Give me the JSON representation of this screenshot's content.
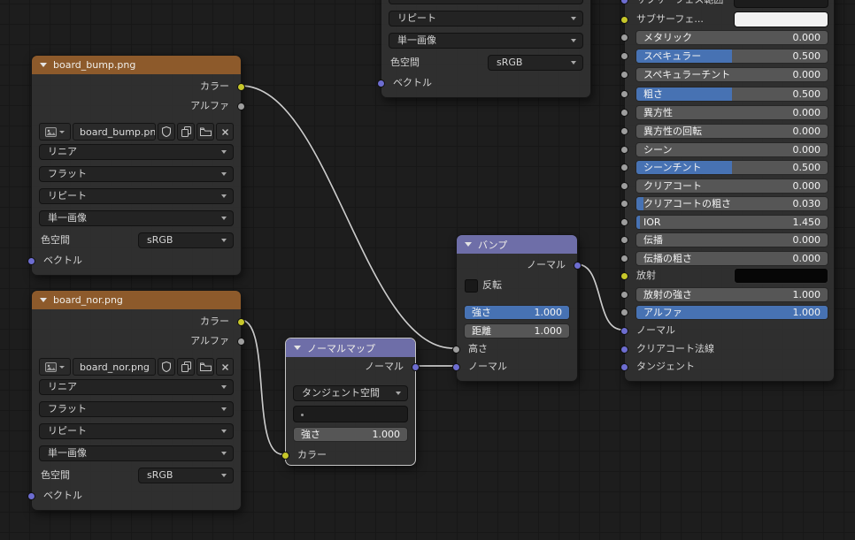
{
  "board_bump": {
    "title": "board_bump.png",
    "outputs": {
      "color": "カラー",
      "alpha": "アルファ"
    },
    "image_name": "board_bump.png",
    "interpolation": "リニア",
    "projection": "フラット",
    "extension": "リピート",
    "source": "単一画像",
    "colorspace_label": "色空間",
    "colorspace_value": "sRGB",
    "vector_label": "ベクトル"
  },
  "board_nor": {
    "title": "board_nor.png",
    "outputs": {
      "color": "カラー",
      "alpha": "アルファ"
    },
    "image_name": "board_nor.png",
    "interpolation": "リニア",
    "projection": "フラット",
    "extension": "リピート",
    "source": "単一画像",
    "colorspace_label": "色空間",
    "colorspace_value": "sRGB",
    "vector_label": "ベクトル"
  },
  "partial_texture": {
    "extension": "リピート",
    "source": "単一画像",
    "colorspace_label": "色空間",
    "colorspace_value": "sRGB",
    "vector_label": "ベクトル"
  },
  "normal_map": {
    "title": "ノーマルマップ",
    "output": "ノーマル",
    "space": "タンジェント空間",
    "strength_label": "強さ",
    "strength_value": "1.000",
    "color_label": "カラー"
  },
  "bump": {
    "title": "バンプ",
    "output": "ノーマル",
    "invert_label": "反転",
    "strength_label": "強さ",
    "strength_value": "1.000",
    "distance_label": "距離",
    "distance_value": "1.000",
    "height_label": "高さ",
    "normal_label": "ノーマル"
  },
  "principled": {
    "radius_label": "サブサーフェス範囲",
    "subsurface_color_label": "サブサーフェ...",
    "sliders": [
      {
        "label": "メタリック",
        "value": "0.000"
      },
      {
        "label": "スペキュラー",
        "value": "0.500"
      },
      {
        "label": "スペキュラーチント",
        "value": "0.000"
      },
      {
        "label": "粗さ",
        "value": "0.500"
      },
      {
        "label": "異方性",
        "value": "0.000"
      },
      {
        "label": "異方性の回転",
        "value": "0.000"
      },
      {
        "label": "シーン",
        "value": "0.000"
      },
      {
        "label": "シーンチント",
        "value": "0.500"
      },
      {
        "label": "クリアコート",
        "value": "0.000"
      },
      {
        "label": "クリアコートの粗さ",
        "value": "0.030"
      },
      {
        "label": "IOR",
        "value": "1.450"
      },
      {
        "label": "伝播",
        "value": "0.000"
      },
      {
        "label": "伝播の粗さ",
        "value": "0.000"
      }
    ],
    "emission_label": "放射",
    "emission_strength": {
      "label": "放射の強さ",
      "value": "1.000"
    },
    "alpha": {
      "label": "アルファ",
      "value": "1.000"
    },
    "normal_label": "ノーマル",
    "clearcoat_normal_label": "クリアコート法線",
    "tangent_label": "タンジェント"
  },
  "colors": {
    "accent_blue": "#4772b3",
    "texture_header": "#8d5a2b",
    "vector_header": "#6e6ea8",
    "socket_color": "#c7c72a",
    "socket_value": "#9e9e9e",
    "socket_vector": "#6d6dd0"
  }
}
